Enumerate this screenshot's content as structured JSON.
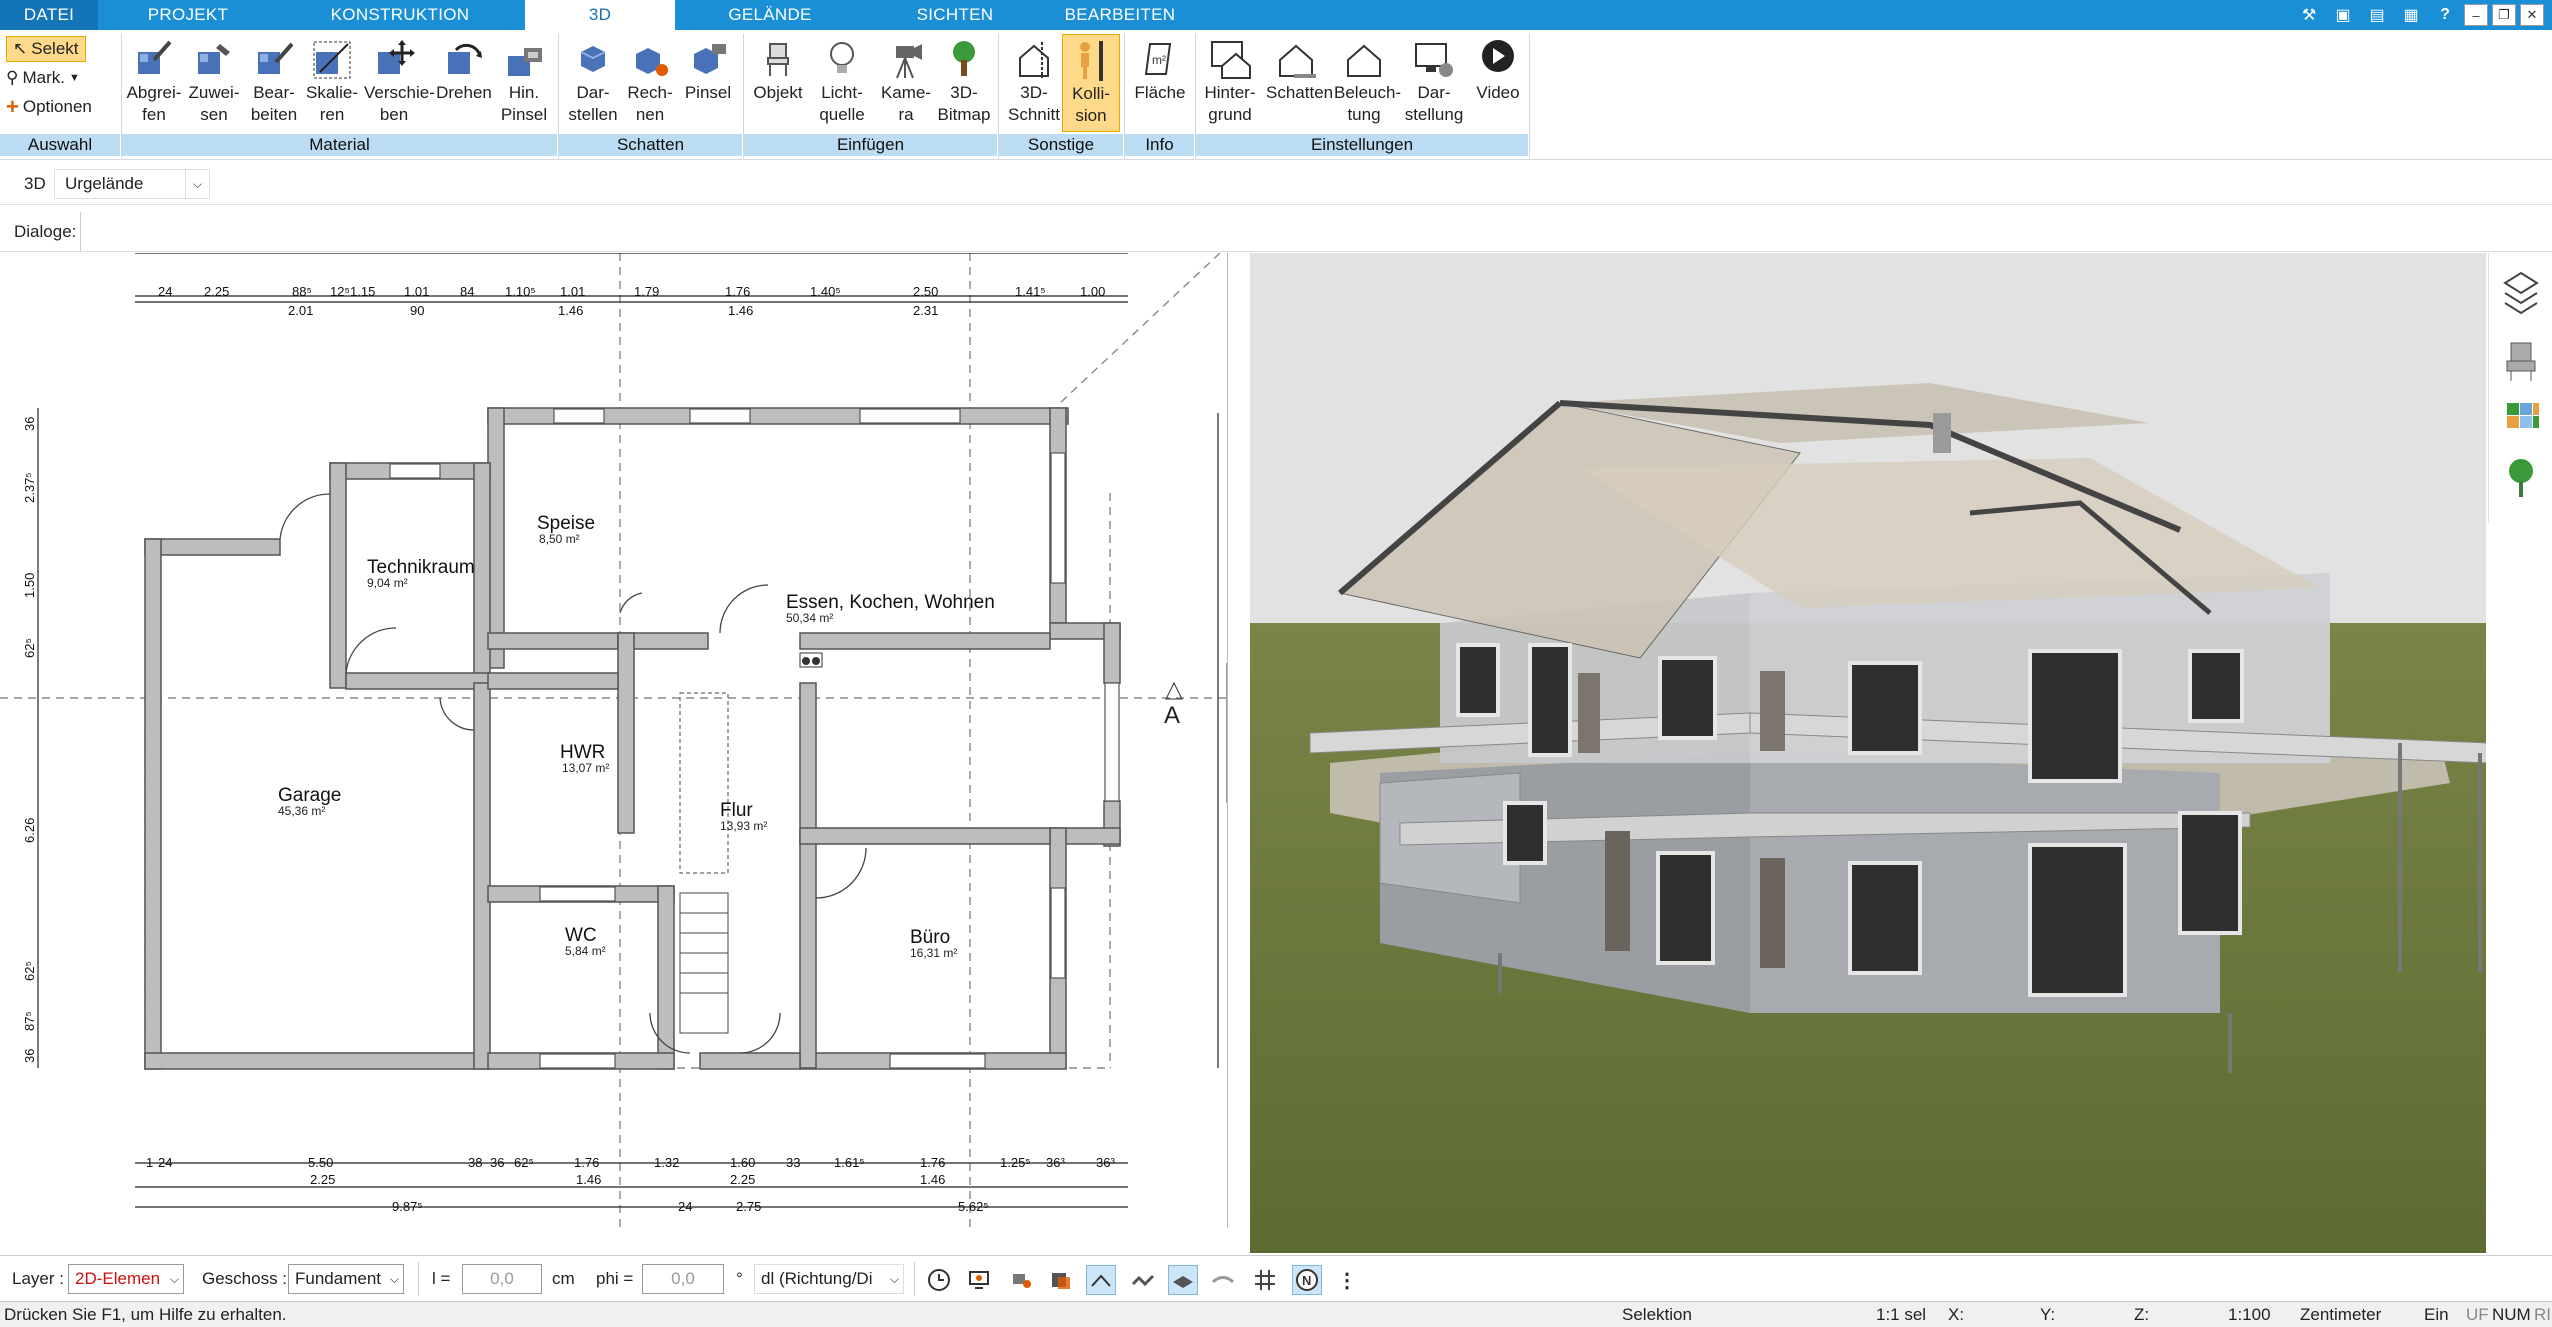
{
  "tabs": [
    {
      "label": "DATEI"
    },
    {
      "label": "PROJEKT"
    },
    {
      "label": "KONSTRUKTION"
    },
    {
      "label": "3D"
    },
    {
      "label": "GELÄNDE"
    },
    {
      "label": "SICHTEN"
    },
    {
      "label": "BEARBEITEN"
    }
  ],
  "auswahl": {
    "selekt": "Selekt",
    "mark": "Mark.",
    "optionen": "Optionen",
    "group": "Auswahl"
  },
  "material": {
    "group": "Material",
    "buttons": [
      "Abgrei-\nfen",
      "Zuwei-\nsen",
      "Bear-\nbeiten",
      "Skalie-\nren",
      "Verschie-\nben",
      "Drehen",
      "Hin.\nPinsel"
    ]
  },
  "schatten": {
    "group": "Schatten",
    "buttons": [
      "Dar-\nstellen",
      "Rech-\nnen",
      "Pinsel"
    ]
  },
  "einfuegen": {
    "group": "Einfügen",
    "buttons": [
      "Objekt",
      "Licht-\nquelle",
      "Kame-\nra",
      "3D-\nBitmap"
    ]
  },
  "sonstige": {
    "group": "Sonstige",
    "buttons": [
      "3D-\nSchnitt",
      "Kolli-\nsion"
    ]
  },
  "info": {
    "group": "Info",
    "buttons": [
      "Fläche"
    ]
  },
  "einstellungen": {
    "group": "Einstellungen",
    "buttons": [
      "Hinter-\ngrund",
      "Schatten",
      "Beleuch-\ntung",
      "Dar-\nstellung",
      "Video"
    ]
  },
  "row2": {
    "mode": "3D",
    "select_value": "Urgelände"
  },
  "row3": {
    "label": "Dialoge:"
  },
  "plan": {
    "rooms": [
      {
        "name": "Technikraum",
        "area": "9,04 m²"
      },
      {
        "name": "Speise",
        "area": "8,50 m²"
      },
      {
        "name": "Essen, Kochen, Wohnen",
        "area": "50,34 m²"
      },
      {
        "name": "Garage",
        "area": "45,36 m²"
      },
      {
        "name": "HWR",
        "area": "13,07 m²"
      },
      {
        "name": "Flur",
        "area": "13,93 m²"
      },
      {
        "name": "WC",
        "area": "5,84 m²"
      },
      {
        "name": "Büro",
        "area": "16,31 m²"
      }
    ],
    "top_dims_a": [
      "24",
      "2.25",
      "88⁵",
      "12⁵",
      "1.15",
      "1.01",
      "84",
      "1.10⁵",
      "1.01",
      "1.79",
      "1.76",
      "1.40⁵",
      "2.50",
      "1.41⁵",
      "1.00"
    ],
    "top_dims_b": [
      "2.01",
      "90",
      "1.46",
      "1.46",
      "2.31"
    ],
    "bottom_dims_a": [
      "1",
      "24",
      "5.50",
      "38",
      "36",
      "62⁵",
      "1.76",
      "1.32",
      "1.60",
      "33",
      "1.61⁵",
      "1.76",
      "1.25⁵",
      "36³",
      "36³"
    ],
    "bottom_dims_b": [
      "2.25",
      "1.46",
      "2.25",
      "1.46"
    ],
    "bottom_dims_c": [
      "9.87⁵",
      "24",
      "2.75",
      "5.62⁵"
    ],
    "left_dims": [
      "36",
      "2.37⁵",
      "1.50",
      "62⁵",
      "6.26",
      "62⁵",
      "87⁵",
      "36"
    ],
    "section_label": "A"
  },
  "bottombar": {
    "layer_label": "Layer :",
    "layer_value": "2D-Elemen",
    "geschoss_label": "Geschoss :",
    "geschoss_value": "Fundament",
    "l_label": "l =",
    "l_value": "0,0",
    "l_unit": "cm",
    "phi_label": "phi =",
    "phi_value": "0,0",
    "phi_unit": "°",
    "dl_value": "dl (Richtung/Di"
  },
  "statusbar": {
    "help": "Drücken Sie F1, um Hilfe zu erhalten.",
    "mode": "Selektion",
    "sel": "1:1 sel",
    "x": "X:",
    "y": "Y:",
    "z": "Z:",
    "scale": "1:100",
    "unit": "Zentimeter",
    "ein": "Ein",
    "uf": "UF",
    "num": "NUM",
    "ri": "RI"
  },
  "colors": {
    "accent": "#1a8fd6",
    "wall": "#8c8c8c",
    "grass": "#6b7a3e",
    "sky": "#e2e2e2",
    "highlight": "#ffd98a"
  }
}
